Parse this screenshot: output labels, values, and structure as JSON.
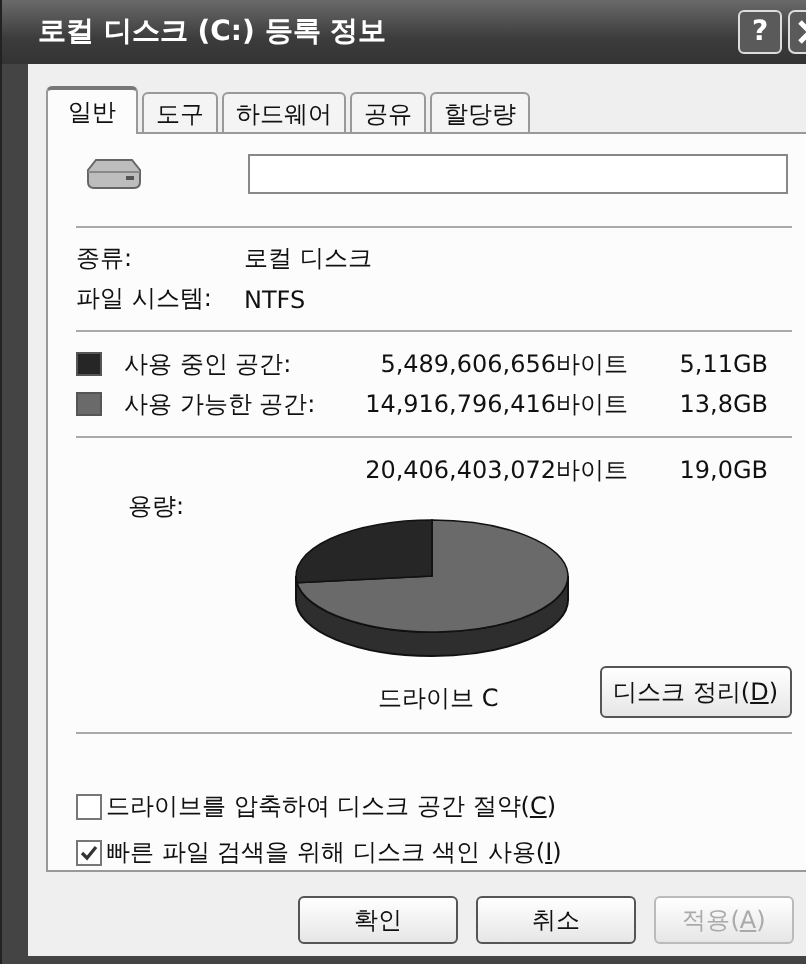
{
  "window": {
    "title": "로컬 디스크 (C:) 등록 정보",
    "help": "?"
  },
  "tabs": [
    {
      "label": "일반",
      "selected": true
    },
    {
      "label": "도구",
      "selected": false
    },
    {
      "label": "하드웨어",
      "selected": false
    },
    {
      "label": "공유",
      "selected": false
    },
    {
      "label": "할당량",
      "selected": false
    }
  ],
  "properties": [
    {
      "label": "종류:",
      "value": "로컬 디스크"
    },
    {
      "label": "파일 시스템:",
      "value": "NTFS"
    }
  ],
  "space": [
    {
      "label": "사용 중인 공간:",
      "bytes": "5,489,606,656바이트",
      "size": "5,11GB",
      "color": "#262626"
    },
    {
      "label": "사용 가능한 공간:",
      "bytes": "14,916,796,416바이트",
      "size": "13,8GB",
      "color": "#6a6a6a"
    }
  ],
  "capacity": {
    "label": "용량:",
    "bytes": "20,406,403,072바이트",
    "size": "19,0GB"
  },
  "drive_label": "드라이브 C",
  "cleanup_button": "디스크 정리(D)",
  "options": [
    {
      "label": "드라이브를 압축하여 디스크 공간 절약(C)",
      "checked": false
    },
    {
      "label": "빠른 파일 검색을 위해 디스크 색인 사용(I)",
      "checked": true
    }
  ],
  "buttons": [
    {
      "label": "확인",
      "disabled": false
    },
    {
      "label": "취소",
      "disabled": false
    },
    {
      "label": "적용(A)",
      "disabled": true
    }
  ]
}
